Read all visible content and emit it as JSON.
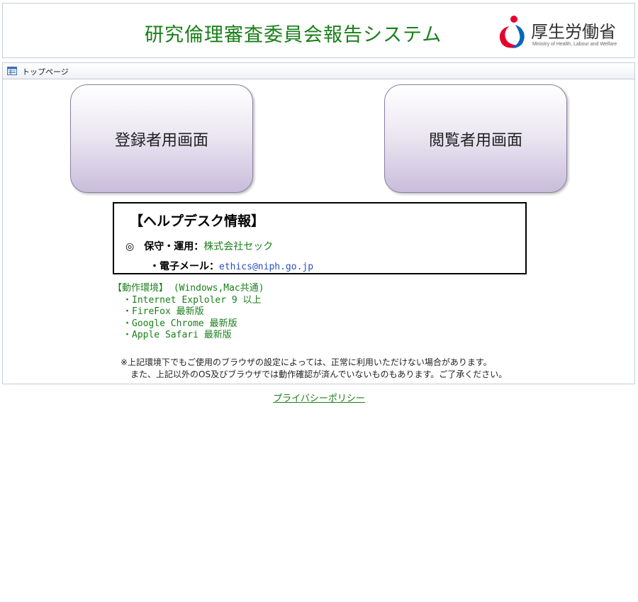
{
  "header": {
    "site_title": "研究倫理審査委員会報告システム",
    "logo_ja": "厚生労働省",
    "logo_en": "Ministry of Health, Labour and Welfare"
  },
  "panel": {
    "title": "トップページ",
    "icon": "page-icon"
  },
  "buttons": {
    "registrant": "登録者用画面",
    "viewer": "閲覧者用画面"
  },
  "helpdesk": {
    "title": "【ヘルプデスク情報】",
    "bullet": "◎",
    "maintenance_label": "保守・運用：",
    "maintenance_value": "株式会社セック",
    "email_label": "・電子メール：",
    "email_value": "ethics@niph.go.jp"
  },
  "environment": {
    "heading": "【動作環境】 (Windows,Mac共通)",
    "items": [
      "・Internet Exploler 9 以上",
      "・FireFox  最新版",
      "・Google  Chrome  最新版",
      "・Apple  Safari  最新版"
    ]
  },
  "notes": {
    "line1": "※上記環境下でもご使用のブラウザの設定によっては、正常に利用いただけない場合があります。",
    "line2": "また、上記以外のOS及びブラウザでは動作確認が済んでいないものもあります。ご了承ください。"
  },
  "footer": {
    "privacy_link": "プライバシーポリシー"
  },
  "colors": {
    "title_green": "#1a7f1a",
    "link_blue": "#2a4fbf",
    "button_border": "#8a7fa0",
    "logo_red": "#e6002d",
    "logo_blue": "#0068b7"
  }
}
